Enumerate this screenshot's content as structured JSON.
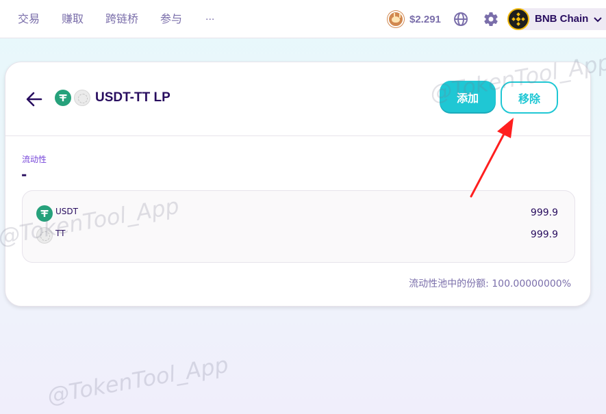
{
  "nav": {
    "items": [
      "交易",
      "赚取",
      "跨链桥",
      "参与",
      "···"
    ],
    "cake_price": "$2.291",
    "chain": "BNB Chain"
  },
  "pool": {
    "title": "USDT-TT LP",
    "add_label": "添加",
    "remove_label": "移除",
    "liquidity_label": "流动性",
    "liquidity_value": "-",
    "tokens": [
      {
        "symbol": "USDT",
        "amount": "999.9",
        "icon": "usdt-logo"
      },
      {
        "symbol": "TT",
        "amount": "999.9",
        "icon": "tt-logo"
      }
    ],
    "share_text": "流动性池中的份额: 100.00000000%"
  },
  "watermark": "@TokenTool_App",
  "colors": {
    "primary": "#1fc7d4",
    "text": "#280d5f",
    "subtle": "#7a6eaa",
    "accent_purple": "#7645d9",
    "annotation_arrow": "#ff1f1f"
  }
}
